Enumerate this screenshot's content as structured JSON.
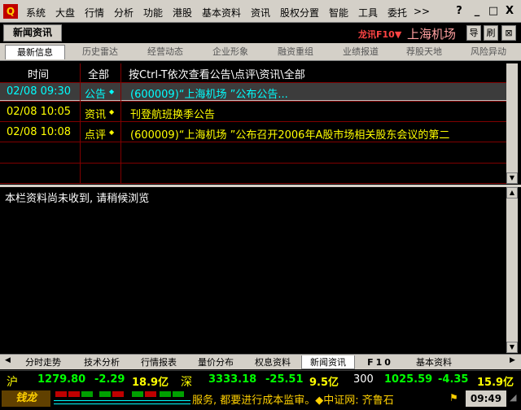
{
  "menubar": {
    "items": [
      "系统",
      "大盘",
      "行情",
      "分析",
      "功能",
      "港股",
      "基本资料",
      "资讯",
      "股权分置",
      "智能",
      "工具",
      "委托",
      ">>"
    ],
    "window_buttons": [
      "?",
      "_",
      "□",
      "X"
    ]
  },
  "titlebar": {
    "tab_label": "新闻资讯",
    "longsoft_tag": "龙讯F10▼",
    "stock_name": "上海机场",
    "buttons": [
      "导",
      "刷",
      "⊠"
    ]
  },
  "subtabs": [
    "最新信息",
    "历史雷达",
    "经营动态",
    "企业形象",
    "融资重组",
    "业绩报道",
    "荐股天地",
    "风险异动"
  ],
  "news": {
    "headers": {
      "time": "时间",
      "type": "全部",
      "title": "按Ctrl-T依次查看公告\\点评\\资讯\\全部"
    },
    "rows": [
      {
        "time": "02/08 09:30",
        "type": "公告",
        "marker": "◆",
        "title": "(600009)“上海机场 ”公布公告...",
        "selected": true
      },
      {
        "time": "02/08 10:05",
        "type": "资讯",
        "marker": "◆",
        "title": "刊登航班换季公告",
        "selected": false
      },
      {
        "time": "02/08 10:08",
        "type": "点评",
        "marker": "◆",
        "title": "(600009)“上海机场 ”公布召开2006年A股市场相关股东会议的第二",
        "selected": false
      }
    ]
  },
  "content": {
    "message": "本栏资料尚未收到, 请稍候浏览"
  },
  "bottom_tabs": [
    "分时走势",
    "技术分析",
    "行情报表",
    "量价分布",
    "权息资料",
    "新闻资讯",
    "F10",
    "基本资料"
  ],
  "indices": {
    "sh": {
      "label": "沪",
      "value": "1279.80",
      "change": "-2.29",
      "amount": "18.9亿"
    },
    "sz": {
      "label": "深",
      "value": "3333.18",
      "change": "-25.51",
      "amount": "9.5亿"
    },
    "hs300": {
      "label": "300",
      "value": "1025.59",
      "change": "-4.35",
      "amount": "15.9亿"
    }
  },
  "status": {
    "brand": "钱龙",
    "ticker": "服务, 都要进行成本监审。◆中证网: 齐鲁石",
    "clock": "09:49"
  },
  "colors": {
    "up_text": "#ffff00",
    "green_text": "#00ff00",
    "cyan": "#00ffff",
    "grid": "#800000"
  }
}
